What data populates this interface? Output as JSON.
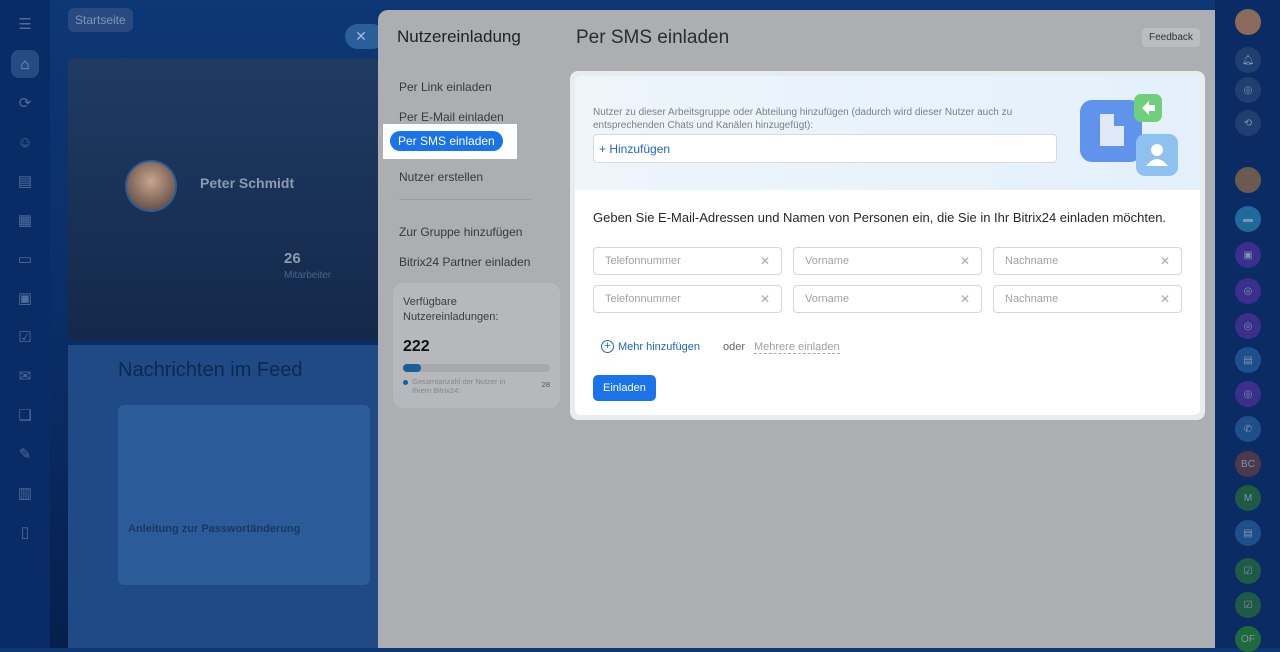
{
  "background": {
    "breadcrumb": "Startseite",
    "profile_name": "Peter Schmidt",
    "employees_count": "26",
    "employees_label": "Mitarbeiter",
    "feed_title": "Nachrichten im Feed",
    "feed_card_title": "Anleitung zur Passwortänderung"
  },
  "right_sidebar": {
    "badges": [
      "BC",
      "M",
      "OF"
    ]
  },
  "panel": {
    "title": "Nutzereinladung",
    "heading": "Per SMS einladen",
    "feedback": "Feedback",
    "menu": [
      "Per Link einladen",
      "Per E-Mail einladen",
      "Per SMS einladen",
      "Nutzer erstellen",
      "Zur Gruppe hinzufügen",
      "Bitrix24 Partner einladen"
    ],
    "stats": {
      "label": "Verfügbare Nutzereinladungen:",
      "count": "222",
      "legend": "Gesamtanzahl der Nutzer in Ihrem Bitrix24:",
      "total": "28",
      "fill_percent": 12
    },
    "group_hint": "Nutzer zu dieser Arbeitsgruppe oder Abteilung hinzufügen (dadurch wird dieser Nutzer auch zu entsprechenden Chats und Kanälen hinzugefügt):",
    "add_label": "+ Hinzufügen",
    "instruction": "Geben Sie E-Mail-Adressen und Namen von Personen ein, die Sie in Ihr Bitrix24 einladen möchten.",
    "placeholders": {
      "phone": "Telefonnummer",
      "first": "Vorname",
      "last": "Nachname"
    },
    "more": "Mehr hinzufügen",
    "or": "oder",
    "multiple": "Mehrere einladen",
    "invite": "Einladen"
  }
}
